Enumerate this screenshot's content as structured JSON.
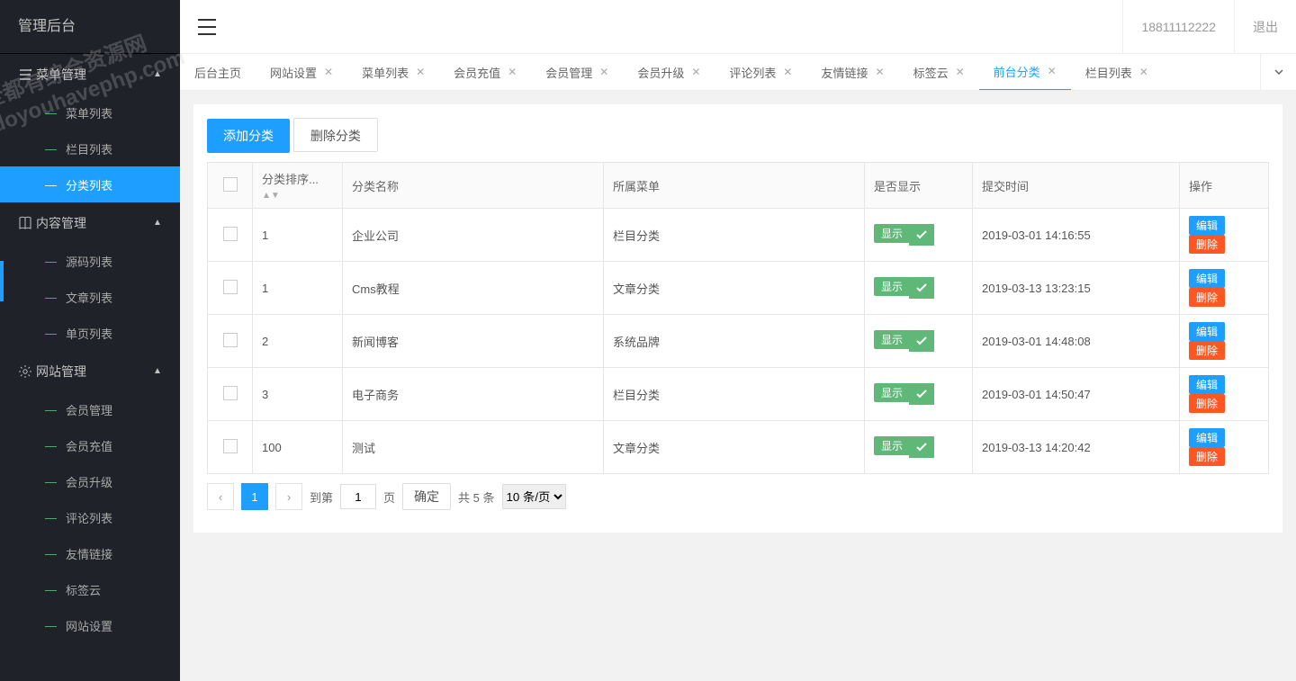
{
  "app_title": "管理后台",
  "sidebar": [
    {
      "label": "菜单管理",
      "expanded": true,
      "children": [
        {
          "label": "菜单列表"
        },
        {
          "label": "栏目列表"
        },
        {
          "label": "分类列表",
          "active": true
        }
      ]
    },
    {
      "label": "内容管理",
      "expanded": true,
      "children": [
        {
          "label": "源码列表"
        },
        {
          "label": "文章列表"
        },
        {
          "label": "单页列表"
        }
      ]
    },
    {
      "label": "网站管理",
      "expanded": true,
      "children": [
        {
          "label": "会员管理"
        },
        {
          "label": "会员充值"
        },
        {
          "label": "会员升级"
        },
        {
          "label": "评论列表"
        },
        {
          "label": "友情链接"
        },
        {
          "label": "标签云"
        },
        {
          "label": "网站设置"
        }
      ]
    }
  ],
  "header": {
    "phone": "18811112222",
    "logout": "退出"
  },
  "tabs": [
    {
      "label": "后台主页",
      "closable": false
    },
    {
      "label": "网站设置",
      "closable": true
    },
    {
      "label": "菜单列表",
      "closable": true
    },
    {
      "label": "会员充值",
      "closable": true
    },
    {
      "label": "会员管理",
      "closable": true
    },
    {
      "label": "会员升级",
      "closable": true
    },
    {
      "label": "评论列表",
      "closable": true
    },
    {
      "label": "友情链接",
      "closable": true
    },
    {
      "label": "标签云",
      "closable": true
    },
    {
      "label": "前台分类",
      "closable": true,
      "active": true
    },
    {
      "label": "栏目列表",
      "closable": true
    }
  ],
  "toolbar": {
    "add": "添加分类",
    "delete": "删除分类"
  },
  "table": {
    "headers": {
      "sort": "分类排序...",
      "name": "分类名称",
      "menu": "所属菜单",
      "show": "是否显示",
      "time": "提交时间",
      "ops": "操作"
    },
    "show_label": "显示",
    "edit_label": "编辑",
    "delete_label": "删除",
    "rows": [
      {
        "sort": "1",
        "name": "企业公司",
        "menu": "栏目分类",
        "time": "2019-03-01 14:16:55"
      },
      {
        "sort": "1",
        "name": "Cms教程",
        "menu": "文章分类",
        "time": "2019-03-13 13:23:15"
      },
      {
        "sort": "2",
        "name": "新闻博客",
        "menu": "系统品牌",
        "time": "2019-03-01 14:48:08"
      },
      {
        "sort": "3",
        "name": "电子商务",
        "menu": "栏目分类",
        "time": "2019-03-01 14:50:47"
      },
      {
        "sort": "100",
        "name": "测试",
        "menu": "文章分类",
        "time": "2019-03-13 14:20:42"
      }
    ]
  },
  "pagination": {
    "current": "1",
    "goto_prefix": "到第",
    "goto_value": "1",
    "goto_suffix": "页",
    "confirm": "确定",
    "total": "共 5 条",
    "per_page": "10 条/页"
  },
  "watermark": "全都有综合资源网\ndoyouhavephp.com"
}
